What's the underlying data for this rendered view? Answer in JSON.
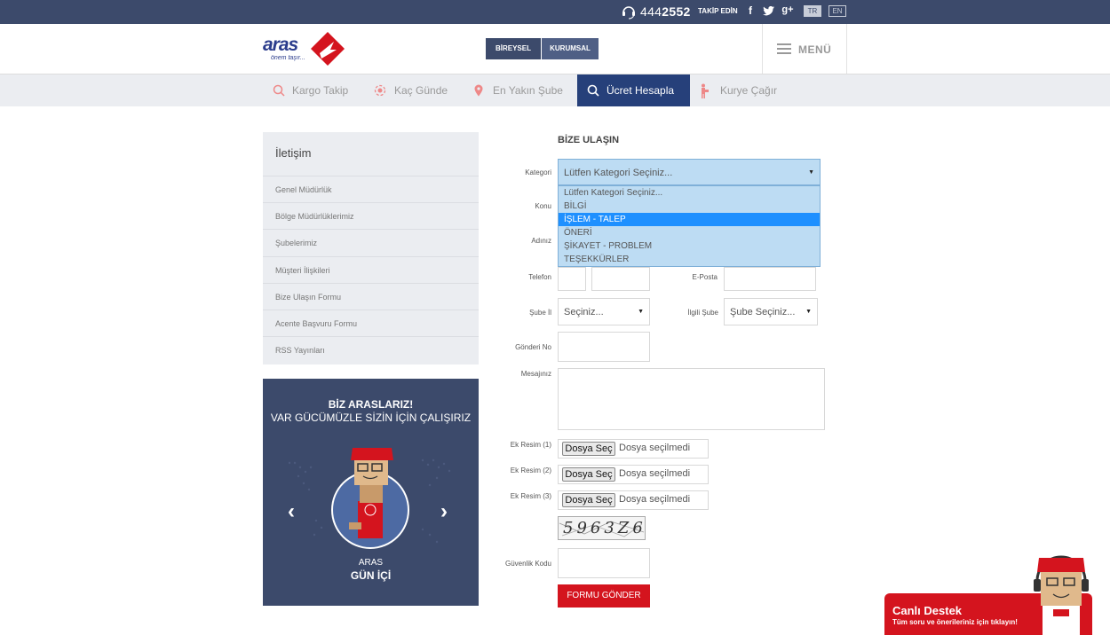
{
  "topbar": {
    "phone_prefix": "444",
    "phone_suffix": "2552",
    "follow_label": "TAKİP EDİN",
    "social": [
      "f",
      "t",
      "g+"
    ],
    "languages": [
      "TR",
      "EN"
    ],
    "active_language": "TR"
  },
  "header": {
    "logo_text": "aras",
    "logo_tagline": "önem taşır...",
    "segments": [
      "BİREYSEL",
      "KURUMSAL"
    ],
    "menu_label": "MENÜ"
  },
  "nav": {
    "items": [
      {
        "label": "Kargo Takip",
        "icon": "search-icon"
      },
      {
        "label": "Kaç Günde",
        "icon": "eye-icon"
      },
      {
        "label": "En Yakın Şube",
        "icon": "location-pin-icon"
      },
      {
        "label": "Ücret Hesapla",
        "icon": "search-icon",
        "active": true
      },
      {
        "label": "Kurye Çağır",
        "icon": "courier-icon"
      }
    ]
  },
  "sidebar": {
    "title": "İletişim",
    "items": [
      "Genel Müdürlük",
      "Bölge Müdürlüklerimiz",
      "Şubelerimiz",
      "Müşteri İlişkileri",
      "Bize Ulaşın Formu",
      "Acente Başvuru Formu",
      "RSS Yayınları"
    ]
  },
  "banner": {
    "line1": "BİZ ARASLARIZ!",
    "line2": "VAR GÜCÜMÜZLE SİZİN İÇİN ÇALIŞIRIZ",
    "line3": "ARAS",
    "line4": "GÜN İÇİ",
    "prev": "‹",
    "next": "›"
  },
  "form": {
    "title": "BİZE ULAŞIN",
    "labels": {
      "kategori": "Kategori",
      "konu": "Konu",
      "adiniz": "Adınız",
      "telefon": "Telefon",
      "eposta": "E-Posta",
      "sube_il": "Şube İl",
      "ilgili_sube": "İlgili Şube",
      "gonderi_no": "Gönderi No",
      "mesajiniz": "Mesajınız",
      "ek1": "Ek Resim (1)",
      "ek2": "Ek Resim (2)",
      "ek3": "Ek Resim (3)",
      "guvenlik": "Güvenlik Kodu"
    },
    "kategori_value": "Lütfen Kategori Seçiniz...",
    "kategori_options": [
      "Lütfen Kategori Seçiniz...",
      "BİLGİ",
      "İŞLEM - TALEP",
      "ÖNERİ",
      "ŞİKAYET - PROBLEM",
      "TEŞEKKÜRLER"
    ],
    "kategori_highlighted_index": 2,
    "sube_il_value": "Seçiniz...",
    "ilgili_sube_value": "Şube Seçiniz...",
    "file_button": "Dosya Seç",
    "file_status": "Dosya seçilmedi",
    "captcha": "5963Z6",
    "submit": "FORMU GÖNDER"
  },
  "live_support": {
    "title": "Canlı Destek",
    "subtitle": "Tüm soru ve önerileriniz için tıklayın!"
  },
  "colors": {
    "navy": "#3c4a6b",
    "nav_active": "#26407a",
    "brand_red": "#d4141e",
    "select_highlight": "#1e90ff"
  }
}
